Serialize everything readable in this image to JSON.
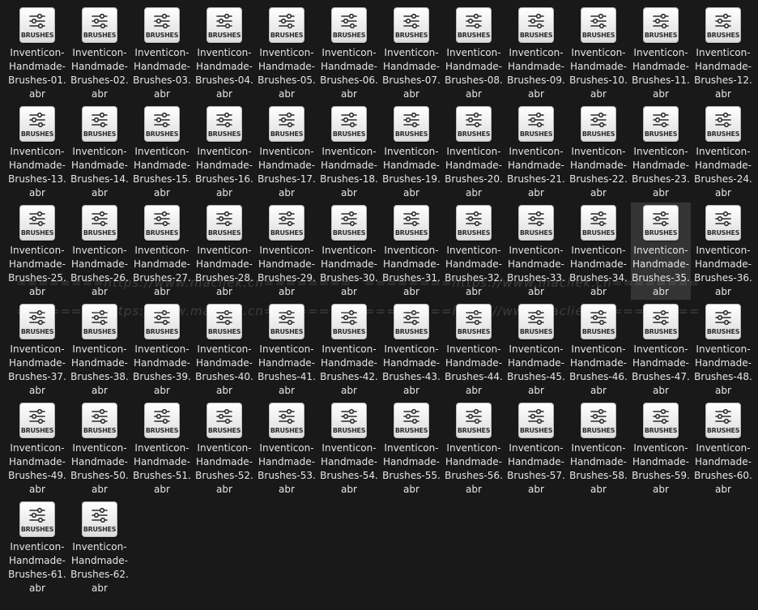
{
  "icon_badge_text": "BRUSHES",
  "icon_semantic": "sliders-icon",
  "selected_index": 34,
  "watermark_text": "========https://www.macliek.cn========",
  "files": [
    {
      "name": "Inventicon-Handmade-Brushes-01.abr"
    },
    {
      "name": "Inventicon-Handmade-Brushes-02.abr"
    },
    {
      "name": "Inventicon-Handmade-Brushes-03.abr"
    },
    {
      "name": "Inventicon-Handmade-Brushes-04.abr"
    },
    {
      "name": "Inventicon-Handmade-Brushes-05.abr"
    },
    {
      "name": "Inventicon-Handmade-Brushes-06.abr"
    },
    {
      "name": "Inventicon-Handmade-Brushes-07.abr"
    },
    {
      "name": "Inventicon-Handmade-Brushes-08.abr"
    },
    {
      "name": "Inventicon-Handmade-Brushes-09.abr"
    },
    {
      "name": "Inventicon-Handmade-Brushes-10.abr"
    },
    {
      "name": "Inventicon-Handmade-Brushes-11.abr"
    },
    {
      "name": "Inventicon-Handmade-Brushes-12.abr"
    },
    {
      "name": "Inventicon-Handmade-Brushes-13.abr"
    },
    {
      "name": "Inventicon-Handmade-Brushes-14.abr"
    },
    {
      "name": "Inventicon-Handmade-Brushes-15.abr"
    },
    {
      "name": "Inventicon-Handmade-Brushes-16.abr"
    },
    {
      "name": "Inventicon-Handmade-Brushes-17.abr"
    },
    {
      "name": "Inventicon-Handmade-Brushes-18.abr"
    },
    {
      "name": "Inventicon-Handmade-Brushes-19.abr"
    },
    {
      "name": "Inventicon-Handmade-Brushes-20.abr"
    },
    {
      "name": "Inventicon-Handmade-Brushes-21.abr"
    },
    {
      "name": "Inventicon-Handmade-Brushes-22.abr"
    },
    {
      "name": "Inventicon-Handmade-Brushes-23.abr"
    },
    {
      "name": "Inventicon-Handmade-Brushes-24.abr"
    },
    {
      "name": "Inventicon-Handmade-Brushes-25.abr"
    },
    {
      "name": "Inventicon-Handmade-Brushes-26.abr"
    },
    {
      "name": "Inventicon-Handmade-Brushes-27.abr"
    },
    {
      "name": "Inventicon-Handmade-Brushes-28.abr"
    },
    {
      "name": "Inventicon-Handmade-Brushes-29.abr"
    },
    {
      "name": "Inventicon-Handmade-Brushes-30.abr"
    },
    {
      "name": "Inventicon-Handmade-Brushes-31.abr"
    },
    {
      "name": "Inventicon-Handmade-Brushes-32.abr"
    },
    {
      "name": "Inventicon-Handmade-Brushes-33.abr"
    },
    {
      "name": "Inventicon-Handmade-Brushes-34.abr"
    },
    {
      "name": "Inventicon-Handmade-Brushes-35.abr"
    },
    {
      "name": "Inventicon-Handmade-Brushes-36.abr"
    },
    {
      "name": "Inventicon-Handmade-Brushes-37.abr"
    },
    {
      "name": "Inventicon-Handmade-Brushes-38.abr"
    },
    {
      "name": "Inventicon-Handmade-Brushes-39.abr"
    },
    {
      "name": "Inventicon-Handmade-Brushes-40.abr"
    },
    {
      "name": "Inventicon-Handmade-Brushes-41.abr"
    },
    {
      "name": "Inventicon-Handmade-Brushes-42.abr"
    },
    {
      "name": "Inventicon-Handmade-Brushes-43.abr"
    },
    {
      "name": "Inventicon-Handmade-Brushes-44.abr"
    },
    {
      "name": "Inventicon-Handmade-Brushes-45.abr"
    },
    {
      "name": "Inventicon-Handmade-Brushes-46.abr"
    },
    {
      "name": "Inventicon-Handmade-Brushes-47.abr"
    },
    {
      "name": "Inventicon-Handmade-Brushes-48.abr"
    },
    {
      "name": "Inventicon-Handmade-Brushes-49.abr"
    },
    {
      "name": "Inventicon-Handmade-Brushes-50.abr"
    },
    {
      "name": "Inventicon-Handmade-Brushes-51.abr"
    },
    {
      "name": "Inventicon-Handmade-Brushes-52.abr"
    },
    {
      "name": "Inventicon-Handmade-Brushes-53.abr"
    },
    {
      "name": "Inventicon-Handmade-Brushes-54.abr"
    },
    {
      "name": "Inventicon-Handmade-Brushes-55.abr"
    },
    {
      "name": "Inventicon-Handmade-Brushes-56.abr"
    },
    {
      "name": "Inventicon-Handmade-Brushes-57.abr"
    },
    {
      "name": "Inventicon-Handmade-Brushes-58.abr"
    },
    {
      "name": "Inventicon-Handmade-Brushes-59.abr"
    },
    {
      "name": "Inventicon-Handmade-Brushes-60.abr"
    },
    {
      "name": "Inventicon-Handmade-Brushes-61.abr"
    },
    {
      "name": "Inventicon-Handmade-Brushes-62.abr"
    }
  ]
}
